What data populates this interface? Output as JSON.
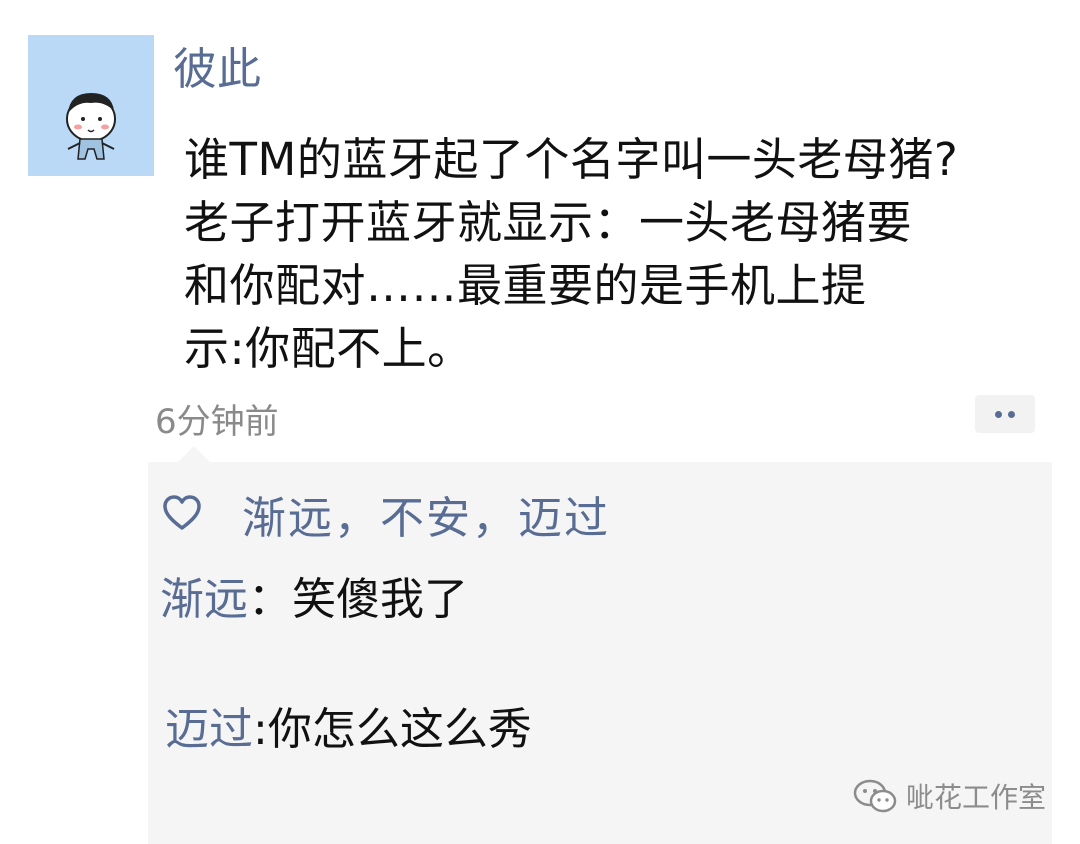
{
  "post": {
    "username": "彼此",
    "text_lines": [
      "谁TM的蓝牙起了个名字叫一头老母猪?",
      "老子打开蓝牙就显示：一头老母猪要",
      "和你配对……最重要的是手机上提",
      "示:你配不上。"
    ],
    "time": "6分钟前",
    "avatar_icon": "cartoon-baby-avatar",
    "more_icon": "more-dots-icon"
  },
  "likes": {
    "icon": "heart-icon",
    "names": "渐远，不安，迈过"
  },
  "comments": [
    {
      "author": "渐远",
      "separator": "：",
      "text": "笑傻我了"
    },
    {
      "author": "迈过",
      "separator": ":",
      "text": "你怎么这么秀"
    }
  ],
  "watermark": {
    "icon": "wechat-icon",
    "text": "呲花工作室"
  },
  "colors": {
    "link": "#586c94",
    "avatar_bg": "#b9d9f7",
    "comment_bg": "#f5f5f5"
  }
}
